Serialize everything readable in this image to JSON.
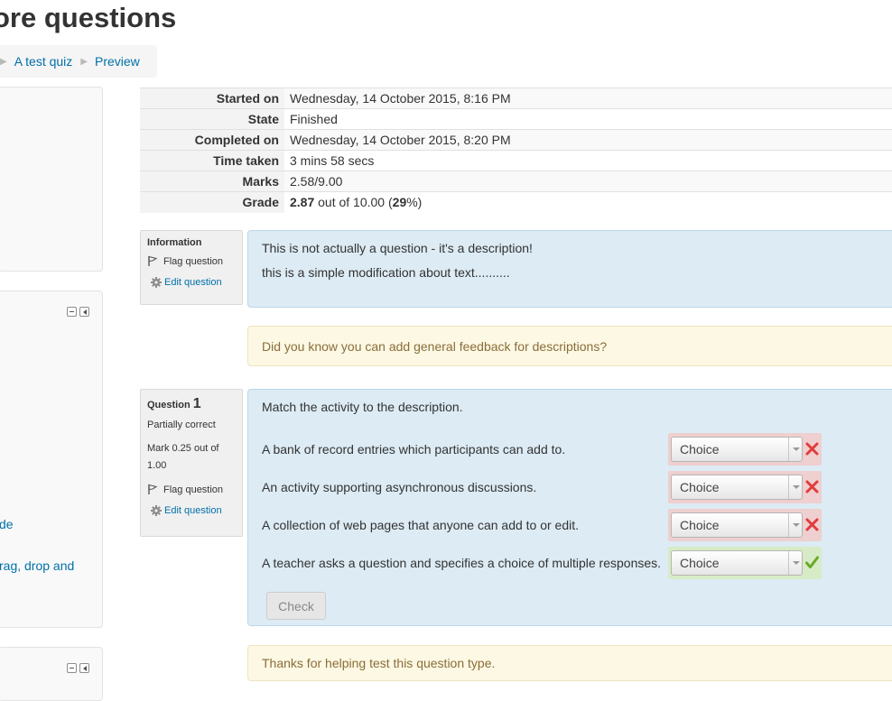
{
  "page": {
    "title": "ore questions"
  },
  "breadcrumb": {
    "items": [
      {
        "label": "A test quiz"
      },
      {
        "label": "Preview"
      }
    ]
  },
  "left_blocks": {
    "block2_links": [
      "de",
      "rag, drop and"
    ]
  },
  "summary": {
    "rows": [
      {
        "label": "Started on",
        "value": "Wednesday, 14 October 2015, 8:16 PM"
      },
      {
        "label": "State",
        "value": "Finished"
      },
      {
        "label": "Completed on",
        "value": "Wednesday, 14 October 2015, 8:20 PM"
      },
      {
        "label": "Time taken",
        "value": "3 mins 58 secs"
      },
      {
        "label": "Marks",
        "value": "2.58/9.00"
      }
    ],
    "grade": {
      "label": "Grade",
      "score": "2.87",
      "out_of_text": " out of 10.00 (",
      "percent": "29",
      "percent_suffix": "%)"
    }
  },
  "information": {
    "title": "Information",
    "flag_label": "Flag question",
    "edit_label": "Edit question",
    "lines": [
      "This is not actually a question - it's a description!",
      "this is a simple modification about text.........."
    ],
    "feedback": "Did you know you can add general feedback for descriptions?"
  },
  "question1": {
    "title": "Question",
    "number": "1",
    "state": "Partially correct",
    "mark_line1": "Mark 0.25 out of",
    "mark_line2": "1.00",
    "flag_label": "Flag question",
    "edit_label": "Edit question",
    "prompt": "Match the activity to the description.",
    "rows": [
      {
        "text": "A bank of record entries which participants can add to.",
        "choice": "Choice",
        "result": "incorrect",
        "result_icon": "cross-icon"
      },
      {
        "text": "An activity supporting asynchronous discussions.",
        "choice": "Choice",
        "result": "incorrect",
        "result_icon": "cross-icon"
      },
      {
        "text": "A collection of web pages that anyone can add to or edit.",
        "choice": "Choice",
        "result": "incorrect",
        "result_icon": "cross-icon"
      },
      {
        "text": "A teacher asks a question and specifies a choice of multiple responses.",
        "choice": "Choice",
        "result": "correct",
        "result_icon": "tick-icon"
      }
    ],
    "check_label": "Check",
    "feedback": "Thanks for helping test this question type."
  },
  "colors": {
    "link": "#0070a8",
    "content_bg": "#dcebf4",
    "feedback_bg": "#fcf8e3",
    "incorrect_bg": "#efcfcf",
    "correct_bg": "#d7ecc6",
    "cross": "#e03c3c",
    "tick": "#6aaa2a"
  }
}
